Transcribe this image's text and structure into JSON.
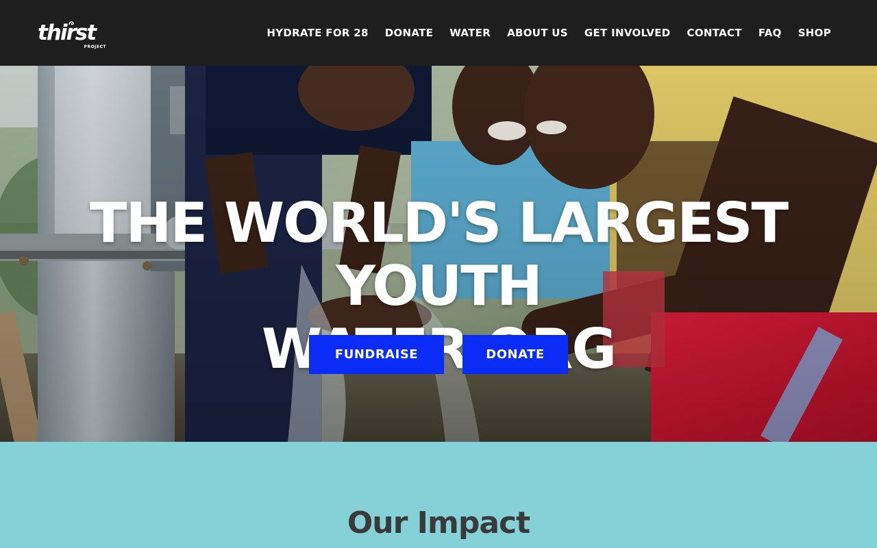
{
  "header": {
    "logo": {
      "word": "thirst",
      "sub": "PROJECT"
    },
    "nav": [
      {
        "label": "HYDRATE FOR 28"
      },
      {
        "label": "DONATE"
      },
      {
        "label": "WATER"
      },
      {
        "label": "ABOUT US"
      },
      {
        "label": "GET INVOLVED"
      },
      {
        "label": "CONTACT"
      },
      {
        "label": "FAQ"
      },
      {
        "label": "SHOP"
      }
    ]
  },
  "hero": {
    "title_line1": "THE WORLD'S LARGEST YOUTH",
    "title_line2": "WATER ORG",
    "fundraise_label": "FUNDRAISE",
    "donate_label": "DONATE"
  },
  "impact": {
    "title": "Our Impact"
  },
  "colors": {
    "header_bg": "#1e1e1e",
    "button_blue": "#0a2cf5",
    "impact_bg": "#84d1d7",
    "impact_text": "#3a3a3a"
  }
}
